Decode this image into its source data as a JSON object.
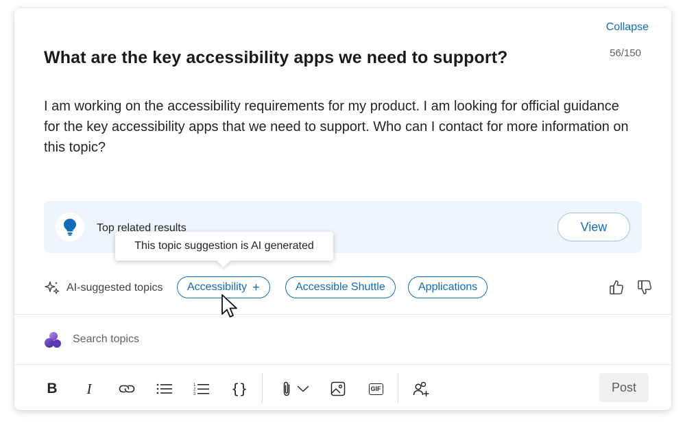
{
  "header": {
    "collapse_label": "Collapse",
    "char_count": "56/150"
  },
  "post": {
    "title": "What are the key accessibility apps we need to support?",
    "body": "I am working on the accessibility requirements for my product. I am looking for official guidance for the key accessibility apps that we need to support. Who can I contact for more information on this topic?"
  },
  "related": {
    "label": "Top related results",
    "view_label": "View",
    "icon": "lightbulb-icon"
  },
  "tooltip": {
    "text": "This topic suggestion is AI generated"
  },
  "topics": {
    "label": "AI-suggested topics",
    "chips": [
      {
        "label": "Accessibility",
        "add": "+"
      },
      {
        "label": "Accessible Shuttle"
      },
      {
        "label": "Applications"
      }
    ]
  },
  "search": {
    "placeholder": "Search topics"
  },
  "toolbar": {
    "items": [
      "bold-icon",
      "italic-icon",
      "link-icon",
      "bullet-list-icon",
      "numbered-list-icon",
      "code-icon",
      "attach-icon",
      "image-icon",
      "gif-icon",
      "mention-people-icon"
    ],
    "bold_glyph": "B",
    "italic_glyph": "I",
    "code_glyph": "{}",
    "gif_glyph": "GIF",
    "post_label": "Post"
  },
  "colors": {
    "accent": "#0f6cbd",
    "related_bg": "#eef5fc",
    "post_bg": "#f0f0f0"
  }
}
